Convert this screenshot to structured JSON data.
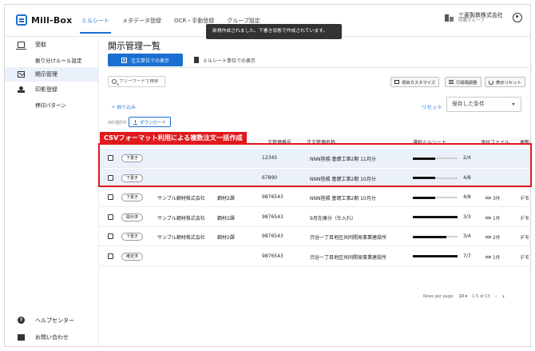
{
  "app": {
    "logo_text": "Mill-Box",
    "nav": [
      "ミルシート",
      "メタデータ登録",
      "OCR・手動登録",
      "グループ設定"
    ],
    "company_name": "三菱製鉄株式会社",
    "company_group": "所属グループ",
    "toast": "新規作成されました。下書き状態で作成されています。"
  },
  "sidebar": {
    "items": [
      {
        "label": "受取",
        "icon": "monitor-icon"
      },
      {
        "label": "振り分けルール設定",
        "icon": ""
      },
      {
        "label": "開示管理",
        "icon": "mail-icon"
      },
      {
        "label": "印影登録",
        "icon": "stamp-icon"
      },
      {
        "label": "押印パターン",
        "icon": ""
      }
    ],
    "bottom": [
      {
        "label": "ヘルプセンター",
        "icon": "help-icon"
      },
      {
        "label": "お問い合わせ",
        "icon": "envelope-icon"
      }
    ]
  },
  "main": {
    "title": "開示管理一覧",
    "tabs": [
      "注文単位での表示",
      "ミルシート単位での表示"
    ],
    "search_placeholder": "フリーワードで検索",
    "toolbar": [
      "項目カスタマイズ",
      "行間隔調整",
      "表示リセット"
    ],
    "filter_label": "＋ 絞り込み",
    "reset_label": "リセット",
    "saved_conditions": "保存した条件",
    "selected_count": "N件選択中",
    "download_label": "ダウンロード",
    "annotation": "CSVフォーマット利用による複数注文一括作成",
    "columns": [
      "文管理番号",
      "注文管理名称",
      "選択ミルシート",
      "添付ファイル",
      "更新者"
    ],
    "rows": [
      {
        "status": "下書き",
        "company": "",
        "dept": "",
        "number": "12345",
        "name": "NNN陸橋 基礎工事2期 11月分",
        "ratio": "2/4",
        "progress": 0.5,
        "attach": "",
        "updater": ""
      },
      {
        "status": "下書き",
        "company": "",
        "dept": "",
        "number": "67890",
        "name": "NNN陸橋 基礎工事2期 10月分",
        "ratio": "4/8",
        "progress": 0.5,
        "attach": "",
        "updater": ""
      },
      {
        "status": "下書き",
        "company": "サンプル鋼材株式会社",
        "dept": "鋼材2課",
        "number": "9876543",
        "name": "NNN陸橋 基礎工事2期 10月分",
        "ratio": "4/8",
        "progress": 0.5,
        "attach": "3件",
        "updater": "デモ"
      },
      {
        "status": "開示済",
        "company": "サンプル鋼材株式会社",
        "dept": "鋼材2課",
        "number": "9876543",
        "name": "9月在庫分（仕入れ）",
        "ratio": "3/3",
        "progress": 1.0,
        "attach": "1件",
        "updater": "デモ"
      },
      {
        "status": "下書き",
        "company": "サンプル鋼材株式会社",
        "dept": "鋼材2課",
        "number": "9876543",
        "name": "渋谷一丁目地区共同開発事業建設所",
        "ratio": "3/4",
        "progress": 0.75,
        "attach": "2件",
        "updater": "デモ"
      },
      {
        "status": "確定済",
        "company": "",
        "dept": "",
        "number": "9876543",
        "name": "渋谷一丁目地区共同開発事業建設所",
        "ratio": "7/7",
        "progress": 1.0,
        "attach": "1件",
        "updater": "デモ"
      }
    ],
    "pager": {
      "rows_label": "Rows per page:",
      "rows_value": "10 ▾",
      "range": "1-5 of 13"
    }
  }
}
